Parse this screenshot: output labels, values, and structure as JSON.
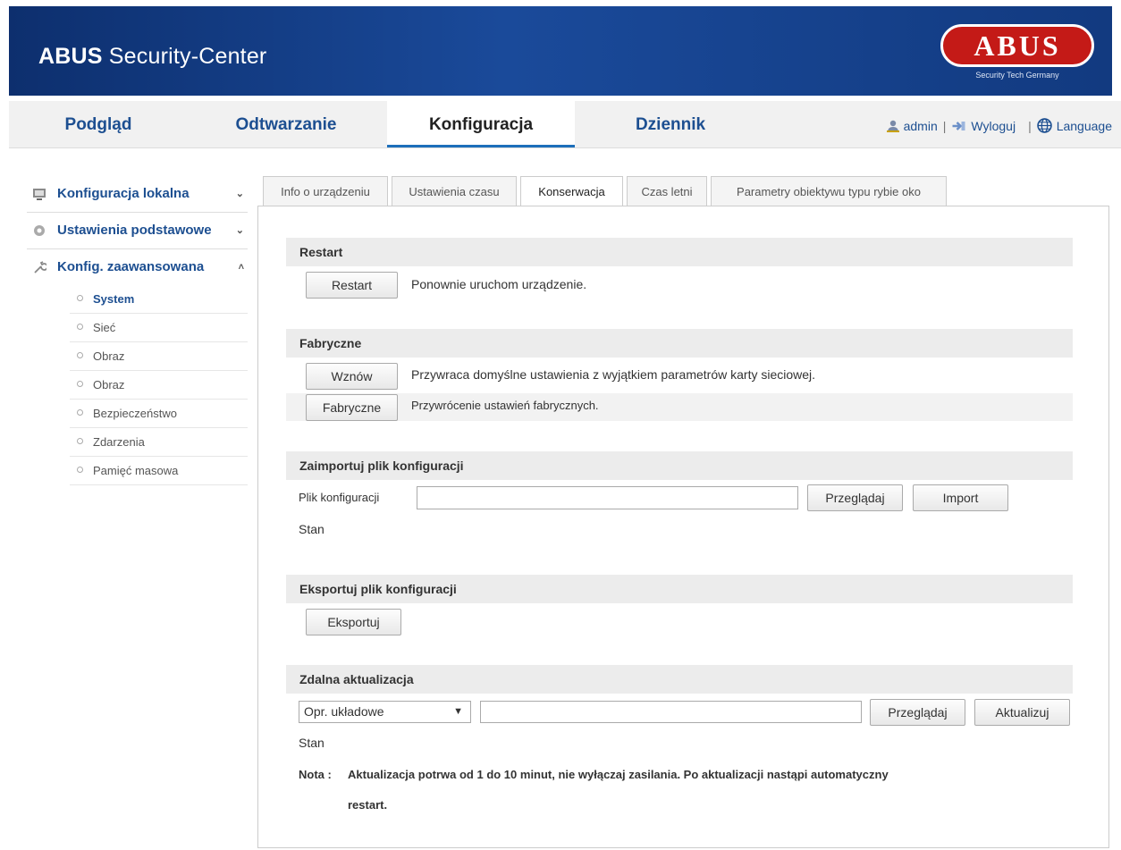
{
  "header": {
    "title_bold": "ABUS",
    "title_rest": " Security-Center",
    "logo_text": "ABUS",
    "logo_sub": "Security Tech Germany"
  },
  "nav": {
    "tabs": [
      "Podgląd",
      "Odtwarzanie",
      "Konfiguracja",
      "Dziennik"
    ],
    "active": "Konfiguracja",
    "user": "admin",
    "logout": "Wyloguj",
    "language": "Language"
  },
  "sidebar": {
    "groups": [
      {
        "label": "Konfiguracja lokalna",
        "chevron": "⌄"
      },
      {
        "label": "Ustawienia podstawowe",
        "chevron": "⌄"
      },
      {
        "label": "Konfig. zaawansowana",
        "chevron": "˄"
      }
    ],
    "items": [
      "System",
      "Sieć",
      "Obraz",
      "Obraz",
      "Bezpieczeństwo",
      "Zdarzenia",
      "Pamięć masowa"
    ],
    "active_item": "System"
  },
  "content_tabs": [
    "Info o urządzeniu",
    "Ustawienia czasu",
    "Konserwacja",
    "Czas letni",
    "Parametry obiektywu typu rybie oko"
  ],
  "active_content_tab": "Konserwacja",
  "restart": {
    "heading": "Restart",
    "button": "Restart",
    "desc": "Ponownie uruchom urządzenie."
  },
  "factory": {
    "heading": "Fabryczne",
    "restore_button": "Wznów",
    "restore_desc": "Przywraca domyślne ustawienia z wyjątkiem parametrów karty sieciowej.",
    "factory_button": "Fabryczne",
    "factory_desc": "Przywrócenie ustawień fabrycznych."
  },
  "import": {
    "heading": "Zaimportuj plik konfiguracji",
    "file_label": "Plik konfiguracji",
    "file_value": "",
    "browse_button": "Przeglądaj",
    "import_button": "Import",
    "status_label": "Stan"
  },
  "export": {
    "heading": "Eksportuj plik konfiguracji",
    "button": "Eksportuj"
  },
  "remote_update": {
    "heading": "Zdalna aktualizacja",
    "select_value": "Opr. układowe",
    "file_value": "",
    "browse_button": "Przeglądaj",
    "update_button": "Aktualizuj",
    "status_label": "Stan",
    "note_label": "Nota :",
    "note_line1": "Aktualizacja potrwa od 1 do 10 minut, nie wyłączaj zasilania. Po aktualizacji nastąpi automatyczny",
    "note_line2": "restart."
  }
}
